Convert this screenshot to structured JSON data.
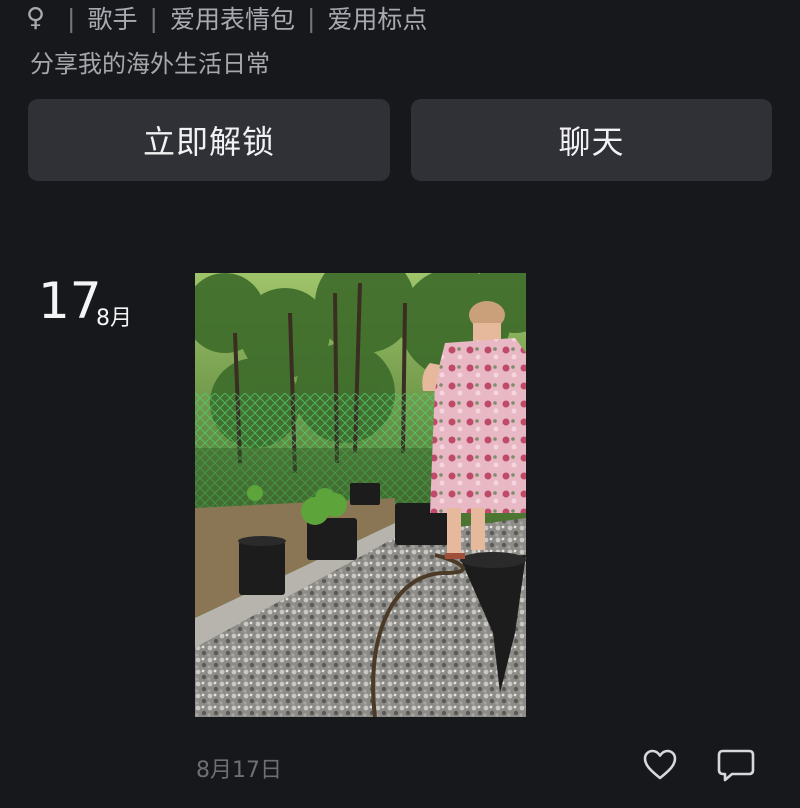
{
  "profile": {
    "gender_icon": "female-icon",
    "gender_symbol": "♀",
    "tags": [
      "歌手",
      "爱用表情包",
      "爱用标点"
    ],
    "separator": "|",
    "bio": "分享我的海外生活日常"
  },
  "actions": {
    "unlock_label": "立即解锁",
    "chat_label": "聊天"
  },
  "post": {
    "day": "17",
    "month": "8月",
    "date_label": "8月17日",
    "like_icon": "heart-icon",
    "comment_icon": "comment-icon"
  },
  "colors": {
    "background": "#17181c",
    "button": "#303136",
    "text_secondary": "#a9aab0",
    "text_muted": "#6e6f75"
  }
}
